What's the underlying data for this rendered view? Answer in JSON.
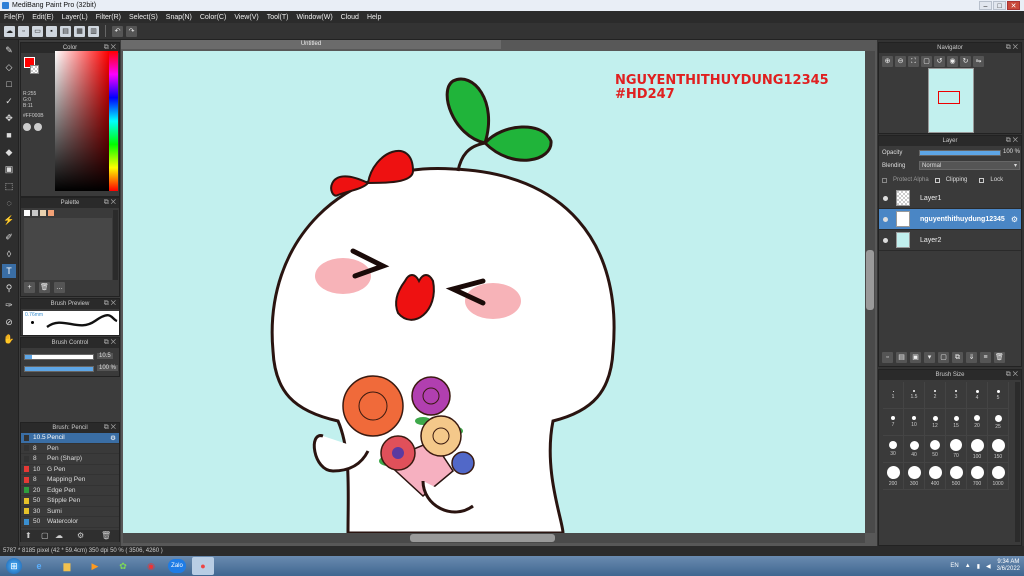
{
  "window": {
    "title": "MediBang Paint Pro (32bit)",
    "minimize": "–",
    "maximize": "□",
    "close": "✕"
  },
  "menu": [
    "File(F)",
    "Edit(E)",
    "Layer(L)",
    "Filter(R)",
    "Select(S)",
    "Snap(N)",
    "Color(C)",
    "View(V)",
    "Tool(T)",
    "Window(W)",
    "Cloud",
    "Help"
  ],
  "document": {
    "tab_title": "Untitled"
  },
  "color_panel": {
    "title": "Color",
    "r": "R:255",
    "g": "G:0",
    "b": "B:11",
    "hex": "#FF000B",
    "fg_color": "#ff0000"
  },
  "palette_panel": {
    "title": "Palette",
    "swatches": [
      "#ffffff",
      "#c9c9c9",
      "#e9d2b0",
      "#f3a276"
    ]
  },
  "brush_preview": {
    "title": "Brush Preview",
    "size_text": "0.76mm"
  },
  "brush_control": {
    "title": "Brush Control",
    "size_value": "10.5",
    "opacity_value": "100 %",
    "size_fraction": 0.1,
    "opacity_fraction": 1.0
  },
  "brush_list": {
    "title": "Brush: Pencil",
    "items": [
      {
        "size": "10.5",
        "name": "Pencil",
        "color": "#333333",
        "selected": true
      },
      {
        "size": "8",
        "name": "Pen",
        "color": "#333333",
        "selected": false
      },
      {
        "size": "8",
        "name": "Pen (Sharp)",
        "color": "#333333",
        "selected": false
      },
      {
        "size": "10",
        "name": "G Pen",
        "color": "#e53935",
        "selected": false
      },
      {
        "size": "8",
        "name": "Mapping Pen",
        "color": "#e53935",
        "selected": false
      },
      {
        "size": "20",
        "name": "Edge Pen",
        "color": "#2e9e3e",
        "selected": false
      },
      {
        "size": "50",
        "name": "Stipple Pen",
        "color": "#e6c229",
        "selected": false
      },
      {
        "size": "30",
        "name": "Sumi",
        "color": "#e6c229",
        "selected": false
      },
      {
        "size": "50",
        "name": "Watercolor",
        "color": "#3a8fd0",
        "selected": false
      }
    ]
  },
  "canvas_text": {
    "line1": "NGUYENTHITHUYDUNG12345",
    "line2": "#HD247"
  },
  "navigator": {
    "title": "Navigator"
  },
  "layer_panel": {
    "title": "Layer",
    "opacity_label": "Opacity",
    "opacity_value": "100 %",
    "blending_label": "Blending",
    "blending_value": "Normal",
    "protect_alpha": "Protect Alpha",
    "clipping": "Clipping",
    "lock": "Lock",
    "layers": [
      {
        "name": "Layer1",
        "selected": false
      },
      {
        "name": "nguyenthithuydung12345",
        "selected": true
      },
      {
        "name": "Layer2",
        "selected": false
      }
    ]
  },
  "brush_size": {
    "title": "Brush Size",
    "sizes": [
      "1",
      "1.5",
      "2",
      "3",
      "4",
      "5",
      "7",
      "10",
      "12",
      "15",
      "20",
      "25",
      "30",
      "40",
      "50",
      "70",
      "100",
      "150",
      "200",
      "300",
      "400",
      "500",
      "700",
      "1000"
    ]
  },
  "status": {
    "text": "5787 * 8185 pixel  (42 * 59.4cm)  350 dpi  50 %  ( 3506, 4260 )"
  },
  "taskbar": {
    "lang": "EN",
    "time": "9:34 AM",
    "date": "3/6/2022",
    "zalo_label": "Zalo"
  }
}
